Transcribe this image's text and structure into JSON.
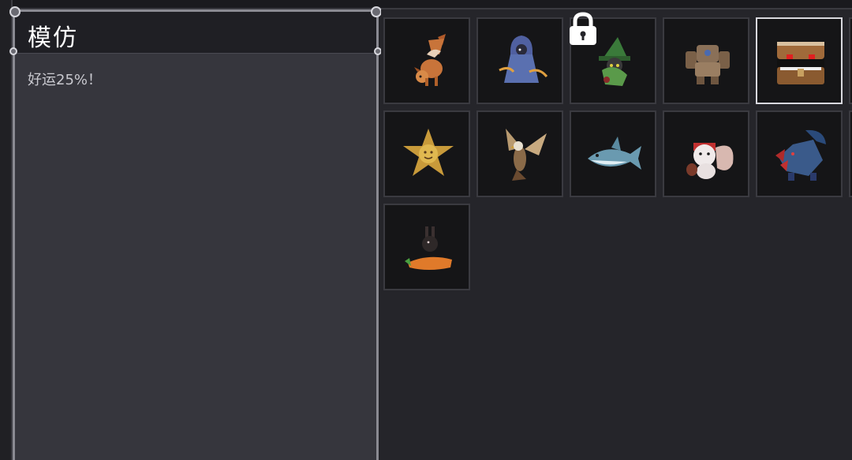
{
  "detail": {
    "title": "模仿",
    "description": "好运25%！"
  },
  "lock": {
    "icon": "lock-icon",
    "visible": true
  },
  "pets": [
    {
      "icon": "fox-icon",
      "selected": false
    },
    {
      "icon": "hooded-ghost-icon",
      "selected": false
    },
    {
      "icon": "witch-cat-icon",
      "selected": false
    },
    {
      "icon": "stone-golem-icon",
      "selected": false
    },
    {
      "icon": "mimic-chest-icon",
      "selected": true
    },
    {
      "icon": "sheriff-star-icon",
      "selected": false
    },
    {
      "icon": "hawk-icon",
      "selected": false
    },
    {
      "icon": "shark-icon",
      "selected": false
    },
    {
      "icon": "squirrel-icon",
      "selected": false
    },
    {
      "icon": "blue-dragon-icon",
      "selected": false
    },
    {
      "icon": "rabbit-carrot-icon",
      "selected": false
    }
  ],
  "colors": {
    "panel_bg": "#36363d",
    "header_bg": "#1f1f24",
    "slot_bg": "#151517",
    "selected_border": "#d8d8de"
  }
}
